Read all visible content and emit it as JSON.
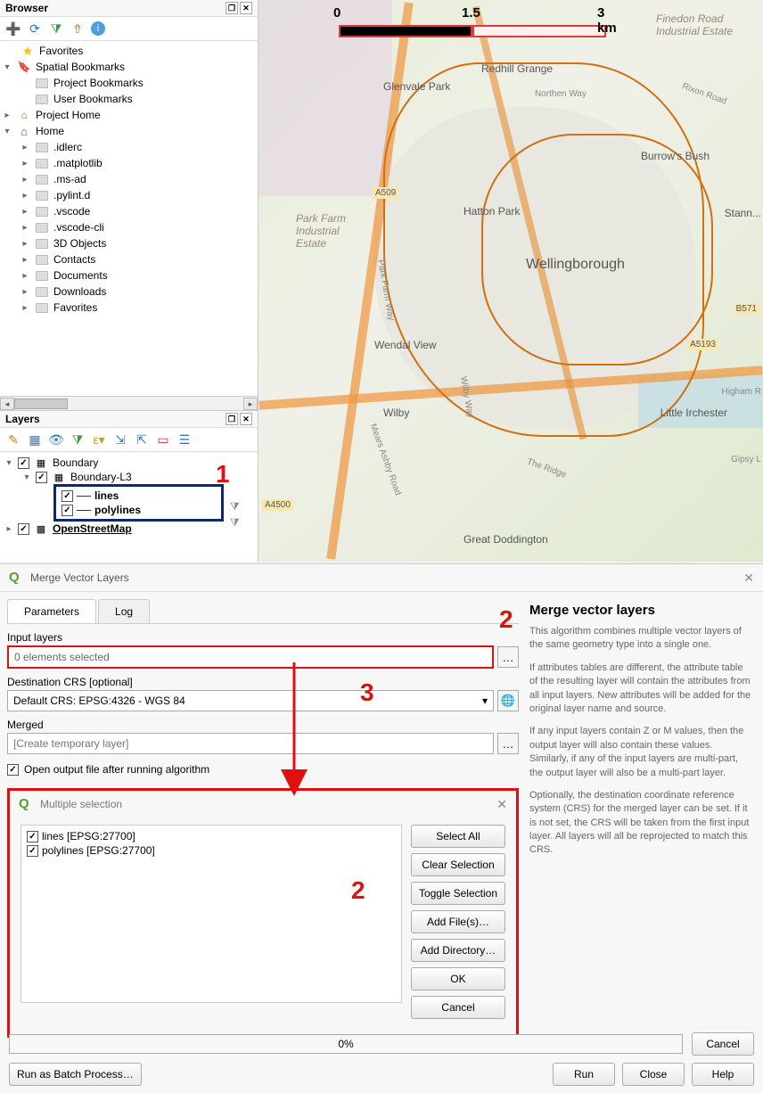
{
  "browser": {
    "title": "Browser",
    "tree": {
      "favorites": "Favorites",
      "spatial_bookmarks": "Spatial Bookmarks",
      "project_bookmarks": "Project Bookmarks",
      "user_bookmarks": "User Bookmarks",
      "project_home": "Project Home",
      "home": "Home",
      "folders": [
        ".idlerc",
        ".matplotlib",
        ".ms-ad",
        ".pylint.d",
        ".vscode",
        ".vscode-cli",
        "3D Objects",
        "Contacts",
        "Documents",
        "Downloads",
        "Favorites"
      ]
    }
  },
  "layers": {
    "title": "Layers",
    "items": {
      "boundary": "Boundary",
      "boundary_l3": "Boundary-L3",
      "lines": "lines",
      "polylines": "polylines",
      "osm": "OpenStreetMap"
    }
  },
  "annotations": {
    "one": "1",
    "two_top": "2",
    "three": "3",
    "two_mid": "2"
  },
  "map": {
    "scale": {
      "t0": "0",
      "t1": "1.5",
      "t2": "3 km"
    },
    "labels": {
      "finedon": "Finedon Road Industrial Estate",
      "redhill": "Redhill Grange",
      "glenvale": "Glenvale Park",
      "northen": "Northen Way",
      "rixon": "Rixon Road",
      "burrows": "Burrow's Bush",
      "a509": "A509",
      "stann": "Stann...",
      "park_farm": "Park Farm Industrial Estate",
      "hatton": "Hatton Park",
      "wellingborough": "Wellingborough",
      "b571": "B571",
      "wendal": "Wendal View",
      "a5193": "A5193",
      "park_farm_way": "Park Farm Way",
      "higham": "Higham R",
      "wilby": "Wilby",
      "wilby_way": "Wilby Way",
      "little_irch": "Little Irchester",
      "gipsy": "Gipsy L",
      "mears": "Mears Ashby Road",
      "the_ridge": "The Ridge",
      "a4500": "A4500",
      "great_dod": "Great Doddington"
    }
  },
  "dialog": {
    "title": "Merge Vector Layers",
    "tabs": {
      "parameters": "Parameters",
      "log": "Log"
    },
    "input_layers_label": "Input layers",
    "input_layers_value": "0 elements selected",
    "dest_crs_label": "Destination CRS [optional]",
    "dest_crs_value": "Default CRS: EPSG:4326 - WGS 84",
    "merged_label": "Merged",
    "merged_placeholder": "[Create temporary layer]",
    "open_output": "Open output file after running algorithm",
    "help": {
      "title": "Merge vector layers",
      "p1": "This algorithm combines multiple vector layers of the same geometry type into a single one.",
      "p2": "If attributes tables are different, the attribute table of the resulting layer will contain the attributes from all input layers. New attributes will be added for the original layer name and source.",
      "p3": "If any input layers contain Z or M values, then the output layer will also contain these values. Similarly, if any of the input layers are multi-part, the output layer will also be a multi-part layer.",
      "p4": "Optionally, the destination coordinate reference system (CRS) for the merged layer can be set. If it is not set, the CRS will be taken from the first input layer. All layers will all be reprojected to match this CRS."
    },
    "multisel": {
      "title": "Multiple selection",
      "items": [
        "lines [EPSG:27700]",
        "polylines [EPSG:27700]"
      ],
      "buttons": {
        "select_all": "Select All",
        "clear": "Clear Selection",
        "toggle": "Toggle Selection",
        "add_files": "Add File(s)…",
        "add_dir": "Add Directory…",
        "ok": "OK",
        "cancel": "Cancel"
      }
    },
    "progress": "0%",
    "buttons": {
      "batch": "Run as Batch Process…",
      "cancel": "Cancel",
      "run": "Run",
      "close": "Close",
      "help": "Help"
    }
  }
}
